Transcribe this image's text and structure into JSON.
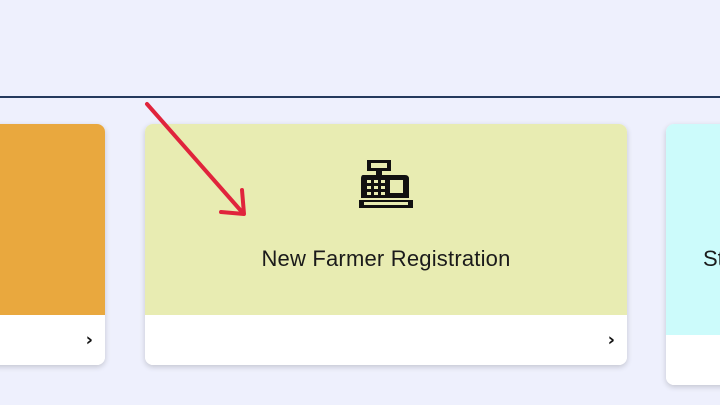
{
  "cards": [
    {
      "title": "",
      "color": "#e9a83e",
      "chevron": "›"
    },
    {
      "title": "New Farmer Registration",
      "icon": "cash-register-icon",
      "color": "#e8ecb2",
      "chevron": "›"
    },
    {
      "title": "St",
      "color": "#ccfbfb"
    }
  ],
  "annotation": {
    "type": "red-arrow",
    "color": "#e0243c"
  }
}
